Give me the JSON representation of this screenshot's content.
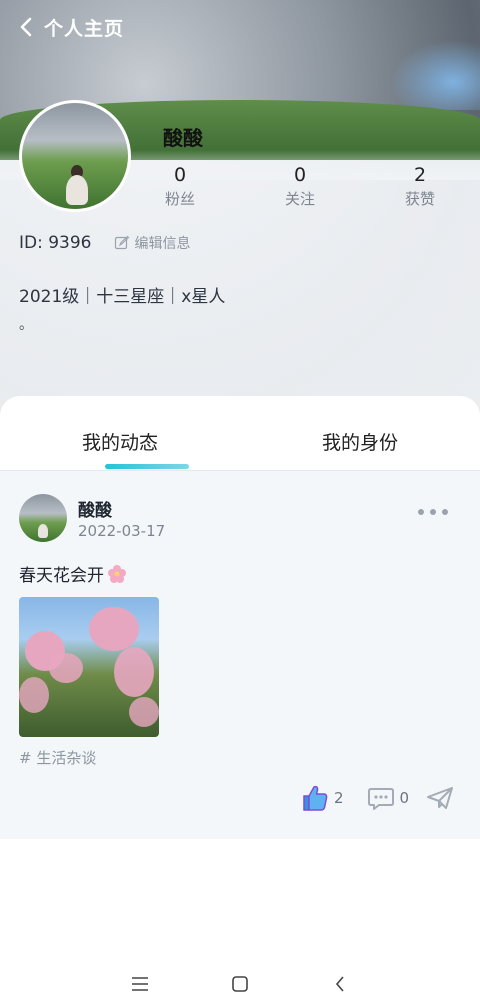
{
  "header": {
    "title": "个人主页"
  },
  "profile": {
    "name": "酸酸",
    "stats": [
      {
        "num": "0",
        "label": "粉丝"
      },
      {
        "num": "0",
        "label": "关注"
      },
      {
        "num": "2",
        "label": "获赞"
      }
    ],
    "id_text": "ID: 9396",
    "edit_label": "编辑信息",
    "tags": "2021级｜十三星座｜x星人",
    "bio": "。"
  },
  "tabs": [
    {
      "label": "我的动态",
      "active": true
    },
    {
      "label": "我的身份",
      "active": false
    }
  ],
  "post": {
    "author": "酸酸",
    "date": "2022-03-17",
    "text": "春天花会开",
    "topic": "# 生活杂谈",
    "likes": "2",
    "comments": "0"
  },
  "colors": {
    "accent": "#25c2d6",
    "like_blue": "#3a8ee6",
    "like_purple": "#7b4fd1"
  },
  "icons": [
    "back-icon",
    "edit-icon",
    "more-icon",
    "flower-icon",
    "like-icon",
    "comment-icon",
    "share-icon",
    "menu-icon",
    "home-icon",
    "back-nav-icon"
  ]
}
